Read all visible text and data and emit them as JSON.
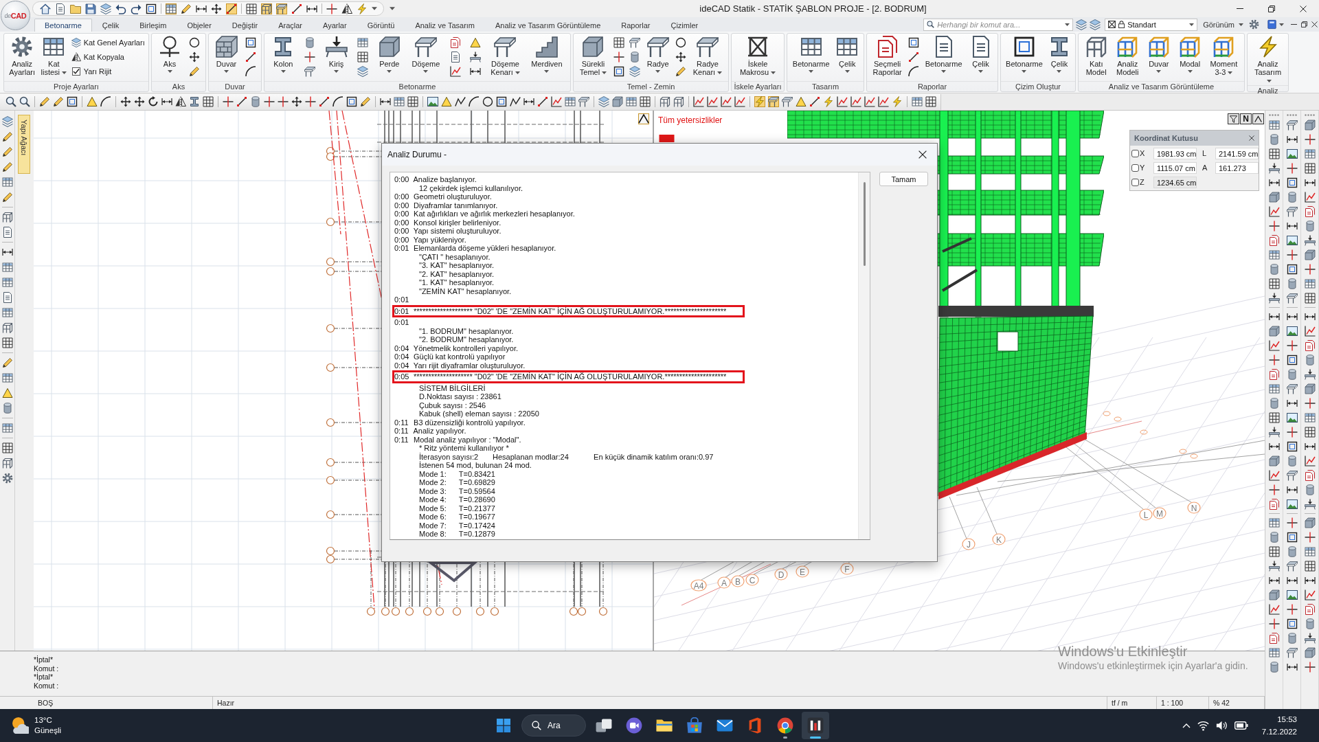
{
  "logo": {
    "prefix": "de",
    "name": "CAD"
  },
  "window": {
    "title": "ideCAD Statik - STATİK ŞABLON PROJE - [2. BODRUM]"
  },
  "ribbon_tabs": [
    {
      "label": "Betonarme",
      "selected": true
    },
    {
      "label": "Çelik",
      "selected": false
    },
    {
      "label": "Birleşim",
      "selected": false
    },
    {
      "label": "Objeler",
      "selected": false
    },
    {
      "label": "Değiştir",
      "selected": false
    },
    {
      "label": "Araçlar",
      "selected": false
    },
    {
      "label": "Ayarlar",
      "selected": false
    },
    {
      "label": "Görüntü",
      "selected": false
    },
    {
      "label": "Analiz ve Tasarım",
      "selected": false
    },
    {
      "label": "Analiz ve Tasarım Görüntüleme",
      "selected": false
    },
    {
      "label": "Raporlar",
      "selected": false
    },
    {
      "label": "Çizimler",
      "selected": false
    }
  ],
  "command_search": {
    "placeholder": "Herhangi bir komut ara..."
  },
  "style_selector": {
    "value": "Standart"
  },
  "view_menu": {
    "label": "Görünüm"
  },
  "ribbon_groups": [
    {
      "title": "Proje Ayarları",
      "items": [
        {
          "kind": "large",
          "label": "Analiz\nAyarları",
          "dropdown": false
        },
        {
          "kind": "large",
          "label": "Kat\nlistesi",
          "dropdown": true
        },
        {
          "kind": "list",
          "entries": [
            {
              "kind": "button",
              "label": "Kat Genel Ayarları"
            },
            {
              "kind": "button",
              "label": "Kat Kopyala"
            },
            {
              "kind": "check",
              "label": "Yarı Rijit",
              "checked": true
            }
          ]
        }
      ]
    },
    {
      "title": "Aks",
      "items": [
        {
          "kind": "large",
          "label": "Aks",
          "dropdown": true
        },
        {
          "kind": "icons"
        }
      ]
    },
    {
      "title": "Duvar",
      "items": [
        {
          "kind": "large",
          "label": "Duvar",
          "dropdown": true
        },
        {
          "kind": "icons"
        }
      ]
    },
    {
      "title": "Betonarme",
      "items": [
        {
          "kind": "large",
          "label": "Kolon",
          "dropdown": true
        },
        {
          "kind": "icons"
        },
        {
          "kind": "large",
          "label": "Kiriş",
          "dropdown": true
        },
        {
          "kind": "icons"
        },
        {
          "kind": "large",
          "label": "Perde",
          "dropdown": true
        },
        {
          "kind": "large",
          "label": "Döşeme",
          "dropdown": true
        },
        {
          "kind": "icons"
        },
        {
          "kind": "icons"
        },
        {
          "kind": "large",
          "label": "Döşeme\nKenarı",
          "dropdown": true
        },
        {
          "kind": "large",
          "label": "Merdiven",
          "dropdown": true
        }
      ]
    },
    {
      "title": "Temel - Zemin",
      "items": [
        {
          "kind": "large",
          "label": "Sürekli\nTemel",
          "dropdown": true
        },
        {
          "kind": "icons"
        },
        {
          "kind": "icons"
        },
        {
          "kind": "large",
          "label": "Radye",
          "dropdown": true
        },
        {
          "kind": "icons"
        },
        {
          "kind": "large",
          "label": "Radye\nKenarı",
          "dropdown": true
        }
      ]
    },
    {
      "title": "İskele Ayarları",
      "items": [
        {
          "kind": "large",
          "label": "İskele\nMakrosu",
          "dropdown": true
        }
      ]
    },
    {
      "title": "Tasarım",
      "items": [
        {
          "kind": "large",
          "label": "Betonarme",
          "dropdown": true
        },
        {
          "kind": "large",
          "label": "Çelik",
          "dropdown": true
        }
      ]
    },
    {
      "title": "Raporlar",
      "items": [
        {
          "kind": "large",
          "label": "Seçmeli\nRaporlar",
          "dropdown": false
        },
        {
          "kind": "icons"
        },
        {
          "kind": "large",
          "label": "Betonarme",
          "dropdown": true
        },
        {
          "kind": "large",
          "label": "Çelik",
          "dropdown": true
        }
      ]
    },
    {
      "title": "Çizim Oluştur",
      "items": [
        {
          "kind": "large",
          "label": "Betonarme",
          "dropdown": true
        },
        {
          "kind": "large",
          "label": "Çelik",
          "dropdown": true
        }
      ]
    },
    {
      "title": "Analiz ve Tasarım Görüntüleme",
      "items": [
        {
          "kind": "large",
          "label": "Katı\nModel",
          "dropdown": false
        },
        {
          "kind": "large",
          "label": "Analiz\nModeli",
          "dropdown": false
        },
        {
          "kind": "large",
          "label": "Duvar",
          "dropdown": true
        },
        {
          "kind": "large",
          "label": "Modal",
          "dropdown": true
        },
        {
          "kind": "large",
          "label": "Moment\n3-3",
          "dropdown": true
        }
      ]
    },
    {
      "title": "Analiz",
      "items": [
        {
          "kind": "large",
          "label": "Analiz\nTasarım",
          "dropdown": true
        }
      ]
    }
  ],
  "structure_tree_tab": {
    "label": "Yapı Ağacı"
  },
  "model_view": {
    "warning": "Tüm yetersizlikler",
    "north_button": "N",
    "coordinate_box": {
      "title": "Koordinat Kutusu",
      "rows": [
        {
          "axis": "X",
          "checked": false,
          "value": "1981.93 cm",
          "disabled": false,
          "extra_label": "L",
          "extra_value": "2141.59 cm"
        },
        {
          "axis": "Y",
          "checked": false,
          "value": "1115.07 cm",
          "disabled": false,
          "extra_label": "A",
          "extra_value": "161.273"
        },
        {
          "axis": "Z",
          "checked": false,
          "value": "1234.65 cm",
          "disabled": true
        }
      ]
    },
    "axis_labels": [
      "A4",
      "A",
      "B",
      "C",
      "D",
      "E",
      "F",
      "J",
      "K",
      "L",
      "M",
      "N"
    ]
  },
  "analysis_dialog": {
    "title": "Analiz Durumu -",
    "ok_button": "Tamam",
    "log": [
      {
        "kind": "entry",
        "time": "0:00",
        "text": "Analize başlanıyor.",
        "highlighted": false
      },
      {
        "kind": "detail",
        "text": "12 çekirdek işlemci kullanılıyor.",
        "highlighted": false
      },
      {
        "kind": "entry",
        "time": "0:00",
        "text": "Geometri oluşturuluyor.",
        "highlighted": false
      },
      {
        "kind": "entry",
        "time": "0:00",
        "text": "Diyaframlar tanımlanıyor.",
        "highlighted": false
      },
      {
        "kind": "entry",
        "time": "0:00",
        "text": "Kat ağırlıkları ve ağırlık merkezleri hesaplanıyor.",
        "highlighted": false
      },
      {
        "kind": "entry",
        "time": "0:00",
        "text": "Konsol kirişler belirleniyor.",
        "highlighted": false
      },
      {
        "kind": "entry",
        "time": "0:00",
        "text": "Yapı sistemi oluşturuluyor.",
        "highlighted": false
      },
      {
        "kind": "entry",
        "time": "0:00",
        "text": "Yapı yükleniyor.",
        "highlighted": false
      },
      {
        "kind": "entry",
        "time": "0:01",
        "text": "Elemanlarda döşeme yükleri hesaplanıyor.",
        "highlighted": false
      },
      {
        "kind": "detail",
        "text": "\"ÇATI \" hesaplanıyor.",
        "highlighted": false
      },
      {
        "kind": "detail",
        "text": "\"3. KAT\" hesaplanıyor.",
        "highlighted": false
      },
      {
        "kind": "detail",
        "text": "\"2. KAT\" hesaplanıyor.",
        "highlighted": false
      },
      {
        "kind": "detail",
        "text": "\"1. KAT\" hesaplanıyor.",
        "highlighted": false
      },
      {
        "kind": "detail",
        "text": "\"ZEMİN KAT\" hesaplanıyor.",
        "highlighted": false
      },
      {
        "kind": "entry",
        "time": "0:01",
        "highlighted": false
      },
      {
        "kind": "entry",
        "time": "0:01",
        "text": "******************** \"D02\" 'DE \"ZEMİN KAT\" İÇİN AĞ OLUŞTURULAMIYOR.*********************",
        "highlighted": true
      },
      {
        "kind": "entry",
        "time": "0:01",
        "highlighted": false
      },
      {
        "kind": "detail",
        "text": "\"1. BODRUM\" hesaplanıyor.",
        "highlighted": false
      },
      {
        "kind": "detail",
        "text": "\"2. BODRUM\" hesaplanıyor.",
        "highlighted": false
      },
      {
        "kind": "entry",
        "time": "0:04",
        "text": "Yönetmelik kontrolleri yapılıyor.",
        "highlighted": false
      },
      {
        "kind": "entry",
        "time": "0:04",
        "text": "Güçlü kat kontrolü yapılıyor",
        "highlighted": false
      },
      {
        "kind": "entry",
        "time": "0:04",
        "text": "Yarı rijit diyaframlar oluşturuluyor.",
        "highlighted": false
      },
      {
        "kind": "entry",
        "time": "0:05",
        "text": "******************** \"D02\" 'DE \"ZEMİN KAT\" İÇİN AĞ OLUŞTURULAMIYOR.*********************",
        "highlighted": true
      },
      {
        "kind": "detail",
        "text": "SİSTEM BİLGİLERİ",
        "highlighted": false
      },
      {
        "kind": "detail",
        "text": "D.Noktası sayısı : 23861",
        "highlighted": false
      },
      {
        "kind": "detail",
        "text": "Çubuk sayısı : 2546",
        "highlighted": false
      },
      {
        "kind": "detail",
        "text": "Kabuk (shell) eleman sayısı : 22050",
        "highlighted": false
      },
      {
        "kind": "entry",
        "time": "0:11",
        "text": "B3 düzensizliği kontrolü yapılıyor.",
        "highlighted": false
      },
      {
        "kind": "entry",
        "time": "0:11",
        "text": "Analiz yapılıyor.",
        "highlighted": false
      },
      {
        "kind": "entry",
        "time": "0:11",
        "text": "Modal analiz yapılıyor : \"Modal\".",
        "highlighted": false
      },
      {
        "kind": "detail",
        "text": "* Ritz yöntemi kullanılıyor *",
        "highlighted": false
      },
      {
        "kind": "columns",
        "cells": [
          "İterasyon sayısı:2",
          "Hesaplanan modlar:24",
          "En küçük dinamik katılım oranı:0.97"
        ],
        "highlighted": false
      },
      {
        "kind": "detail",
        "text": "İstenen 54 mod, bulunan 24 mod.",
        "highlighted": false
      },
      {
        "kind": "mode",
        "label": "Mode 1:",
        "value": "T=0.83421",
        "highlighted": false
      },
      {
        "kind": "mode",
        "label": "Mode 2:",
        "value": "T=0.69829",
        "highlighted": false
      },
      {
        "kind": "mode",
        "label": "Mode 3:",
        "value": "T=0.59564",
        "highlighted": false
      },
      {
        "kind": "mode",
        "label": "Mode 4:",
        "value": "T=0.28690",
        "highlighted": false
      },
      {
        "kind": "mode",
        "label": "Mode 5:",
        "value": "T=0.21377",
        "highlighted": false
      },
      {
        "kind": "mode",
        "label": "Mode 6:",
        "value": "T=0.19677",
        "highlighted": false
      },
      {
        "kind": "mode",
        "label": "Mode 7:",
        "value": "T=0.17424",
        "highlighted": false
      },
      {
        "kind": "mode",
        "label": "Mode 8:",
        "value": "T=0.12879",
        "highlighted": false
      }
    ]
  },
  "command_line": {
    "lines": [
      "*İptal*",
      "Komut :",
      "*İptal*",
      "Komut :"
    ]
  },
  "status_bar": {
    "cells": [
      "BOŞ",
      "Hazır",
      "tf / m",
      "1 : 100",
      "% 42"
    ]
  },
  "activation_notice": {
    "title": "Windows'u Etkinleştir",
    "text": "Windows'u etkinleştirmek için Ayarlar'a gidin."
  },
  "taskbar": {
    "weather": {
      "temperature": "13°C",
      "condition": "Güneşli"
    },
    "search_label": "Ara",
    "apps": [
      {
        "kind": "taskview",
        "running": false,
        "selected": false
      },
      {
        "kind": "chat",
        "running": false,
        "selected": false
      },
      {
        "kind": "folder",
        "running": false,
        "selected": false
      },
      {
        "kind": "store",
        "running": false,
        "selected": false
      },
      {
        "kind": "mail",
        "running": false,
        "selected": false
      },
      {
        "kind": "office",
        "running": false,
        "selected": false
      },
      {
        "kind": "browser",
        "running": true,
        "selected": false
      },
      {
        "kind": "cad",
        "running": true,
        "selected": true
      }
    ],
    "clock": {
      "time": "15:53",
      "date": "7.12.2022"
    }
  }
}
